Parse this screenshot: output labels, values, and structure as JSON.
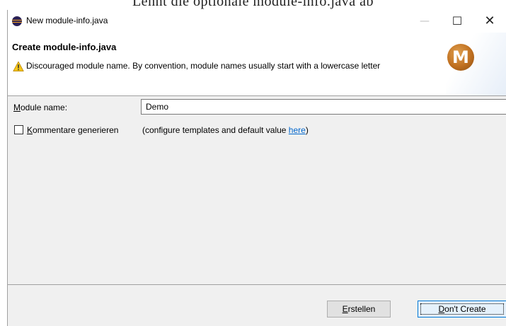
{
  "caption": "Lehnt die optionale module-info.java ab",
  "window": {
    "title": "New module-info.java",
    "controls": {
      "minimize": "—",
      "maximize": "☐",
      "close": "✕"
    }
  },
  "banner": {
    "title": "Create module-info.java",
    "warning_icon": "warning-icon",
    "message": "Discouraged module name. By convention, module names usually start with a lowercase letter",
    "logo_letter": "M"
  },
  "form": {
    "module_name_label": "Module name:",
    "module_name_value": "Demo",
    "comments_checkbox_checked": false,
    "comments_label": "Kommentare generieren",
    "configure_prefix": "(configure templates and default value ",
    "configure_link": "here",
    "configure_suffix": ")"
  },
  "buttons": {
    "create": "Erstellen",
    "dont_create": "Don't Create"
  },
  "colors": {
    "link": "#0066cc",
    "focus_border": "#0078d7",
    "logo": "#c07020"
  }
}
